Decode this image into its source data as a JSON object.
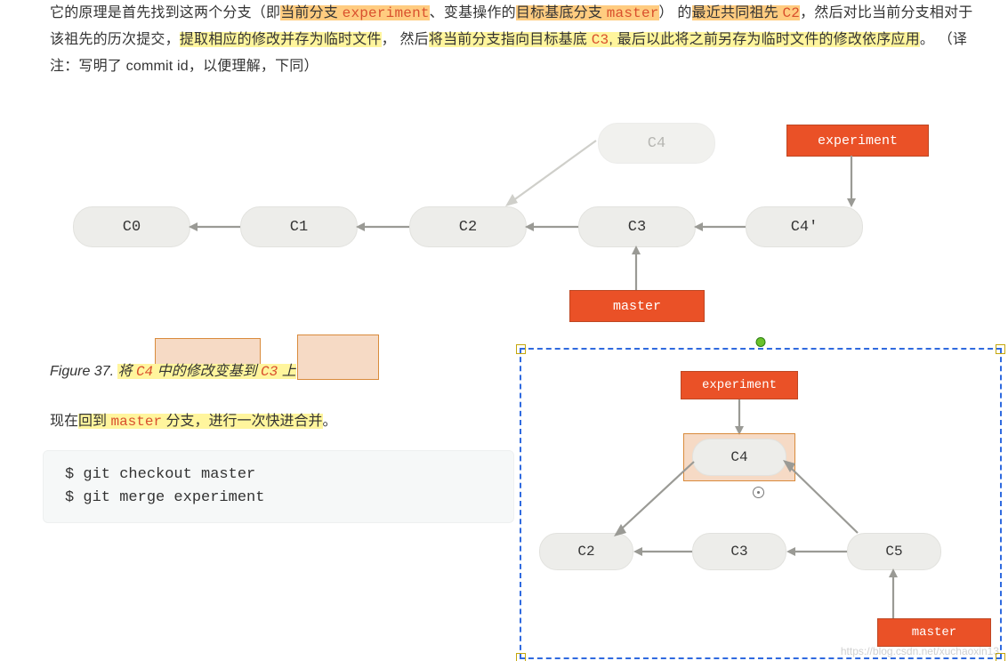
{
  "para": {
    "t1": "它的原理是首先找到这两个分支（即",
    "t2": "当前分支 ",
    "t3": "experiment",
    "t4": "、变基操作的",
    "t5": "目标基底分支 ",
    "t6": "master",
    "t7": "） 的",
    "t8": "最近共同祖先 ",
    "t9": "C2",
    "t10": "，然后对比当前分支相对于该祖先的历次提交，",
    "t11": "提取相应的修改并存为临时文件",
    "t12": "， 然后",
    "t13": "将当前分支指向目标基底 ",
    "t14": "C3",
    "t15": ", 最后以此将之前另存为临时文件的修改依序应用",
    "t16": "。 （译注：写明了 commit id，以便理解，下同）"
  },
  "fig1": {
    "c0": "C0",
    "c1": "C1",
    "c2": "C2",
    "c3": "C3",
    "c4": "C4",
    "c4p": "C4'",
    "experiment": "experiment",
    "master": "master"
  },
  "caption": {
    "prefix": "Figure 37. ",
    "p1": "将 ",
    "p2": "C4",
    "p3": " 中的修改变基到 ",
    "p4": "C3",
    "p5": " 上"
  },
  "midtext": {
    "t1": "现在",
    "t2": "回到 ",
    "t3": "master",
    "t4": " 分支，进行一次快进合并",
    "t5": "。"
  },
  "code": "$ git checkout master\n$ git merge experiment",
  "fig2": {
    "c2": "C2",
    "c3": "C3",
    "c4": "C4",
    "c5": "C5",
    "experiment": "experiment",
    "master": "master"
  },
  "watermark": "https://blog.csdn.net/xuchaoxin13"
}
